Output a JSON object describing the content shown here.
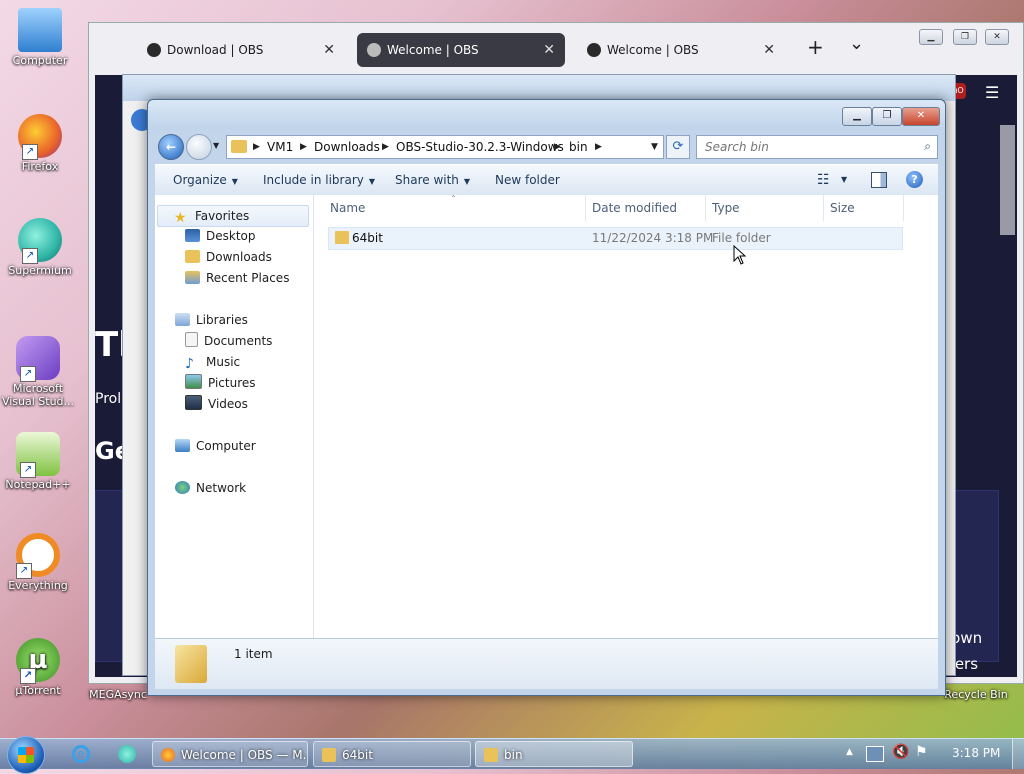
{
  "desktop_icons": [
    {
      "label": "Computer",
      "color": "#4aa3e8"
    },
    {
      "label": "Firefox",
      "color": "#e8632a"
    },
    {
      "label": "Supermium",
      "color": "#2fb5a6"
    },
    {
      "label": "Microsoft Visual Stud...",
      "color": "#8b5cd6"
    },
    {
      "label": "Notepad++",
      "color": "#7fc241"
    },
    {
      "label": "Everything",
      "color": "#f08a24"
    },
    {
      "label": "µTorrent",
      "color": "#5aae3b"
    },
    {
      "label": "MEGAsync",
      "color": ""
    },
    {
      "label": "Recycle Bin",
      "color": ""
    }
  ],
  "browser": {
    "tabs": [
      {
        "title": "Download | OBS",
        "active": false
      },
      {
        "title": "Welcome | OBS",
        "active": true
      },
      {
        "title": "Welcome | OBS",
        "active": false
      }
    ],
    "new_tab": "+",
    "tab_list": "⌄",
    "page_fragments": [
      "Th",
      "Prol",
      "Ge",
      "lown",
      "sers"
    ]
  },
  "explorer": {
    "breadcrumbs": [
      "VM1",
      "Downloads",
      "OBS-Studio-30.2.3-Windows",
      "bin"
    ],
    "search_placeholder": "Search bin",
    "commands": {
      "organize": "Organize",
      "include_in_library": "Include in library",
      "share_with": "Share with",
      "new_folder": "New folder"
    },
    "nav": {
      "favorites": "Favorites",
      "desktop": "Desktop",
      "downloads": "Downloads",
      "recent_places": "Recent Places",
      "libraries": "Libraries",
      "documents": "Documents",
      "music": "Music",
      "pictures": "Pictures",
      "videos": "Videos",
      "computer": "Computer",
      "network": "Network"
    },
    "columns": {
      "name": "Name",
      "date_modified": "Date modified",
      "type": "Type",
      "size": "Size"
    },
    "files": [
      {
        "name": "64bit",
        "date_modified": "11/22/2024 3:18 PM",
        "type": "File folder",
        "size": ""
      }
    ],
    "status": "1 item"
  },
  "taskbar": {
    "items": [
      {
        "label": "Welcome | OBS — M...",
        "color": "#e8632a"
      },
      {
        "label": "64bit",
        "color": "#e9c25a"
      },
      {
        "label": "bin",
        "color": "#e9c25a"
      }
    ],
    "clock": "3:18 PM"
  },
  "colors": {
    "folder": "#e9c25a",
    "accent": "#1e395b",
    "close_red": "#c6452d"
  }
}
